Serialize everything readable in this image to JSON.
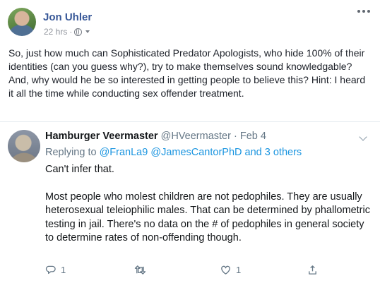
{
  "post": {
    "author": "Jon Uhler",
    "time": "22 hrs",
    "separator": "·",
    "text": "So, just how much can Sophisticated Predator Apologists, who hide 100% of their identities (can you guess why?), try to make themselves sound knowledgable? And, why would he be so interested in getting people to believe this? Hint: I heard it all the time while conducting sex offender treatment."
  },
  "tweet": {
    "name": "Hamburger Veermaster",
    "handle": "@HVeermaster",
    "separator": "·",
    "date": "Feb 4",
    "replying_prefix": "Replying to",
    "mention_1": "@FranLa9",
    "mention_2": "@JamesCantorPhD",
    "others_joiner": "and",
    "others": "3 others",
    "paragraph_1": "Can't infer that.",
    "paragraph_2": "Most people who molest children are not pedophiles. They are usually heterosexual teleiophilic males. That can be determined by phallometric testing in jail. There's no data on the # of pedophiles in general society to determine rates of non-offending though.",
    "actions": {
      "reply_count": "1",
      "like_count": "1"
    }
  },
  "colors": {
    "fb_link": "#385898",
    "twitter_link": "#1b95e0",
    "muted": "#657786"
  }
}
